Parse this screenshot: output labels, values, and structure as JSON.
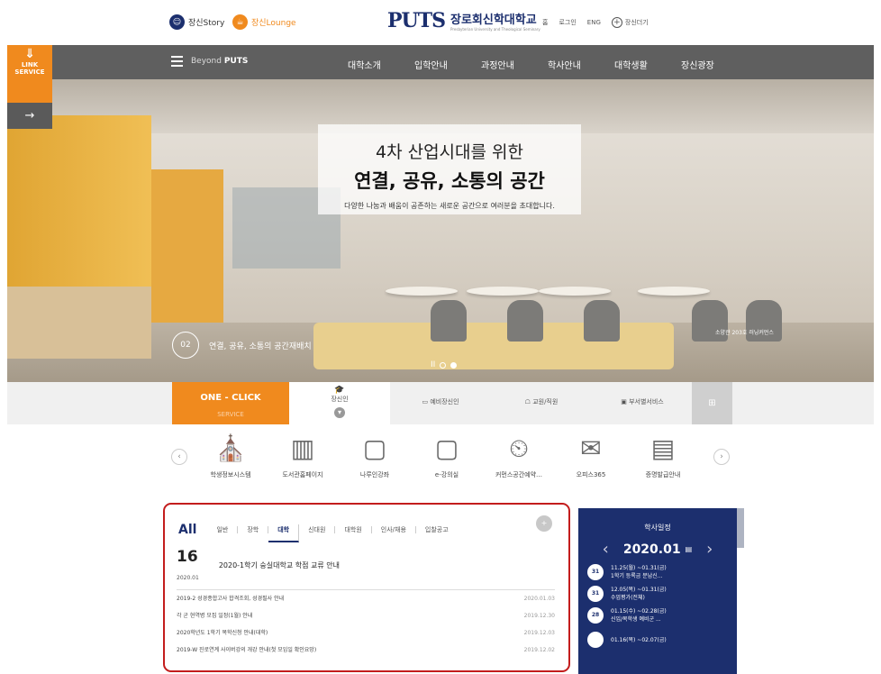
{
  "topbar": {
    "story": "장신Story",
    "lounge": "장신Lounge",
    "logo_mark": "PUTS",
    "school_name": "장로회신학대학교",
    "school_en": "Presbyterian University and Theological Seminary",
    "home": "홈",
    "login": "로그인",
    "eng": "ENG",
    "add": "장신더기"
  },
  "nav": {
    "beyond": "Beyond",
    "puts": "PUTS",
    "menu": [
      "대학소개",
      "입학안내",
      "과정안내",
      "학사안내",
      "대학생활",
      "장신광장"
    ]
  },
  "link_service": {
    "line1": "LINK",
    "line2": "SERVICE",
    "arrow": "→"
  },
  "hero": {
    "line1": "4차 산업시대를 위한",
    "line2": "연결, 공유, 소통의 공간",
    "line3": "다양한 나눔과 배움이 공존하는 새로운 공간으로 여러분을 초대합니다.",
    "slide_no": "02",
    "slide_text": "연결, 공유, 소통의 공간재배치",
    "credit": "소양관 203호 러닝커먼스",
    "pause": "II"
  },
  "oneclick": {
    "title": "ONE - CLICK",
    "sub": "SERVICE",
    "tabs": [
      "장신인",
      "예비장신인",
      "교원/직원",
      "부서별서비스"
    ],
    "grid": "⊞"
  },
  "services": [
    "학생정보시스템",
    "도서관홈페이지",
    "나루인강좌",
    "e-강의실",
    "커먼스공간예약…",
    "오피스365",
    "증명발급안내"
  ],
  "notice": {
    "all": "All",
    "tabs": [
      "일반",
      "장학",
      "대학",
      "신대원",
      "대학원",
      "인사/채용",
      "입찰공고"
    ],
    "active_tab": "대학",
    "plus": "+",
    "featured": {
      "day": "16",
      "ym": "2020.01",
      "title": "2020-1학기 숭실대학교 학점 교류 안내"
    },
    "items": [
      {
        "title": "2019-2 성경종합고사 합격조회, 성경필사 안내",
        "date": "2020.01.03"
      },
      {
        "title": "각 군 현역병 모집 일정(1월) 안내",
        "date": "2019.12.30"
      },
      {
        "title": "2020학년도 1학기 복학신청 안내(대학)",
        "date": "2019.12.03"
      },
      {
        "title": "2019-W 진로연계 사이버강의 개강 안내(첫 모임일 확인요망)",
        "date": "2019.12.02"
      }
    ]
  },
  "calendar": {
    "title": "학사일정",
    "month": "2020.01",
    "events": [
      {
        "day": "31",
        "range": "11.25(월) ~01.31(금)",
        "label": "1학기 등록금 분납신..."
      },
      {
        "day": "31",
        "range": "12.05(목) ~01.31(금)",
        "label": "수업평가(전체)"
      },
      {
        "day": "28",
        "range": "01.15(수) ~02.28(금)",
        "label": "신입/복학생 예비군 ..."
      },
      {
        "day": "",
        "range": "01.16(목) ~02.07(금)",
        "label": ""
      }
    ]
  }
}
